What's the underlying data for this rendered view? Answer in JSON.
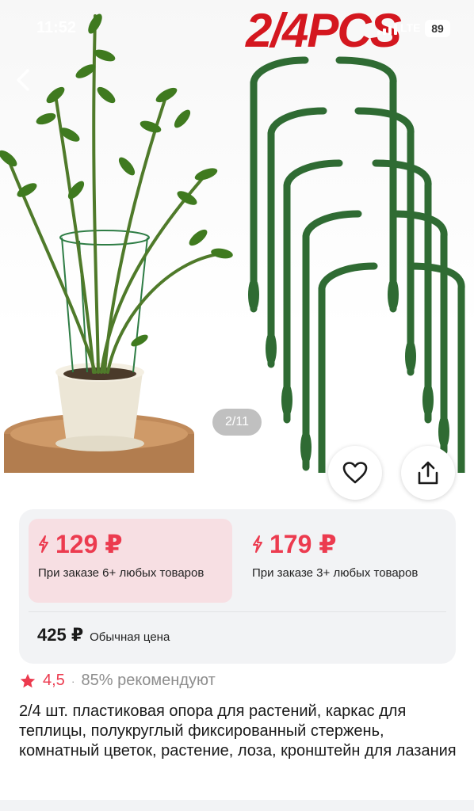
{
  "status_bar": {
    "time": "11:52",
    "network": "LTE",
    "battery": "89"
  },
  "gallery": {
    "promo_text": "2/4PCS",
    "page_indicator": "2/11"
  },
  "pricing": {
    "offers": [
      {
        "price": "129 ₽",
        "condition": "При заказе 6+ любых товаров"
      },
      {
        "price": "179 ₽",
        "condition": "При заказе 3+ любых товаров"
      }
    ],
    "regular_price": "425 ₽",
    "regular_label": "Обычная цена"
  },
  "rating": {
    "value": "4,5",
    "recommend": "85% рекомендуют"
  },
  "product": {
    "title": "2/4 шт. пластиковая опора для растений, каркас для теплицы, полукруглый фиксированный стержень, комнатный цветок, растение, лоза, кронштейн для лазания"
  },
  "colors": {
    "accent": "#ec3b4f",
    "promo": "#d4171f",
    "stake_green": "#2f6b33"
  },
  "icons": [
    "back-arrow-icon",
    "lightning-icon",
    "star-icon",
    "heart-icon",
    "share-icon"
  ]
}
